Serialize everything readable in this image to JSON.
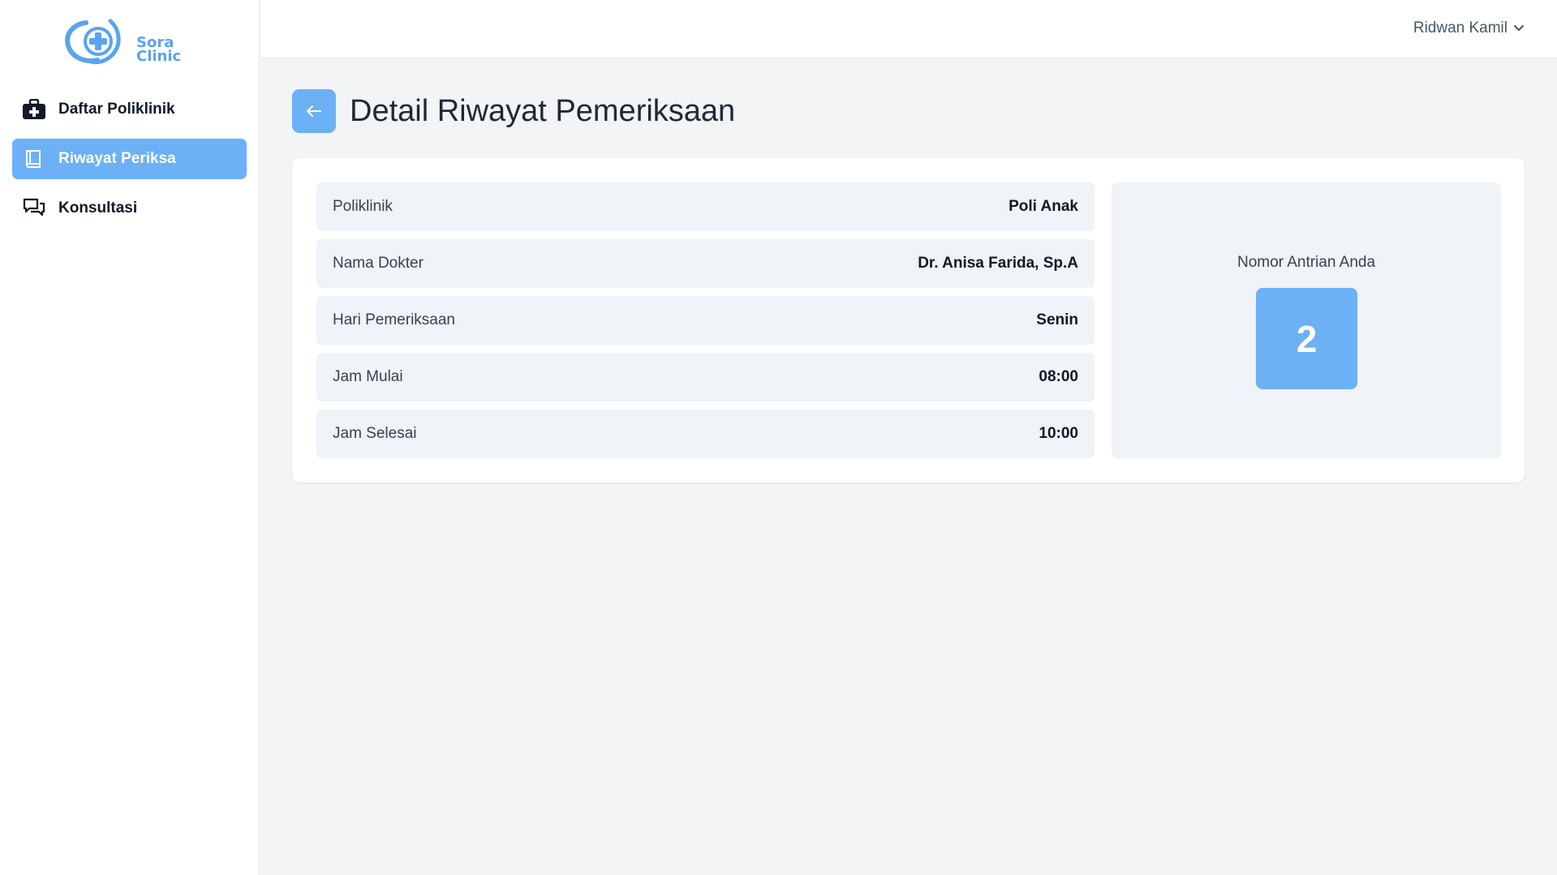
{
  "app": {
    "brand_line1": "Sora",
    "brand_line2": "Clinic",
    "accent_color": "#6cb0f6"
  },
  "sidebar": {
    "items": [
      {
        "label": "Daftar Poliklinik",
        "icon": "medical-bag-icon",
        "active": false
      },
      {
        "label": "Riwayat Periksa",
        "icon": "book-icon",
        "active": true
      },
      {
        "label": "Konsultasi",
        "icon": "chat-bubbles-icon",
        "active": false
      }
    ]
  },
  "header": {
    "user_name": "Ridwan Kamil"
  },
  "page": {
    "title": "Detail Riwayat Pemeriksaan",
    "back_icon": "arrow-left-icon"
  },
  "details": [
    {
      "label": "Poliklinik",
      "value": "Poli Anak"
    },
    {
      "label": "Nama Dokter",
      "value": "Dr. Anisa Farida, Sp.A"
    },
    {
      "label": "Hari Pemeriksaan",
      "value": "Senin"
    },
    {
      "label": "Jam Mulai",
      "value": "08:00"
    },
    {
      "label": "Jam Selesai",
      "value": "10:00"
    }
  ],
  "queue": {
    "label": "Nomor Antrian Anda",
    "number": "2"
  }
}
